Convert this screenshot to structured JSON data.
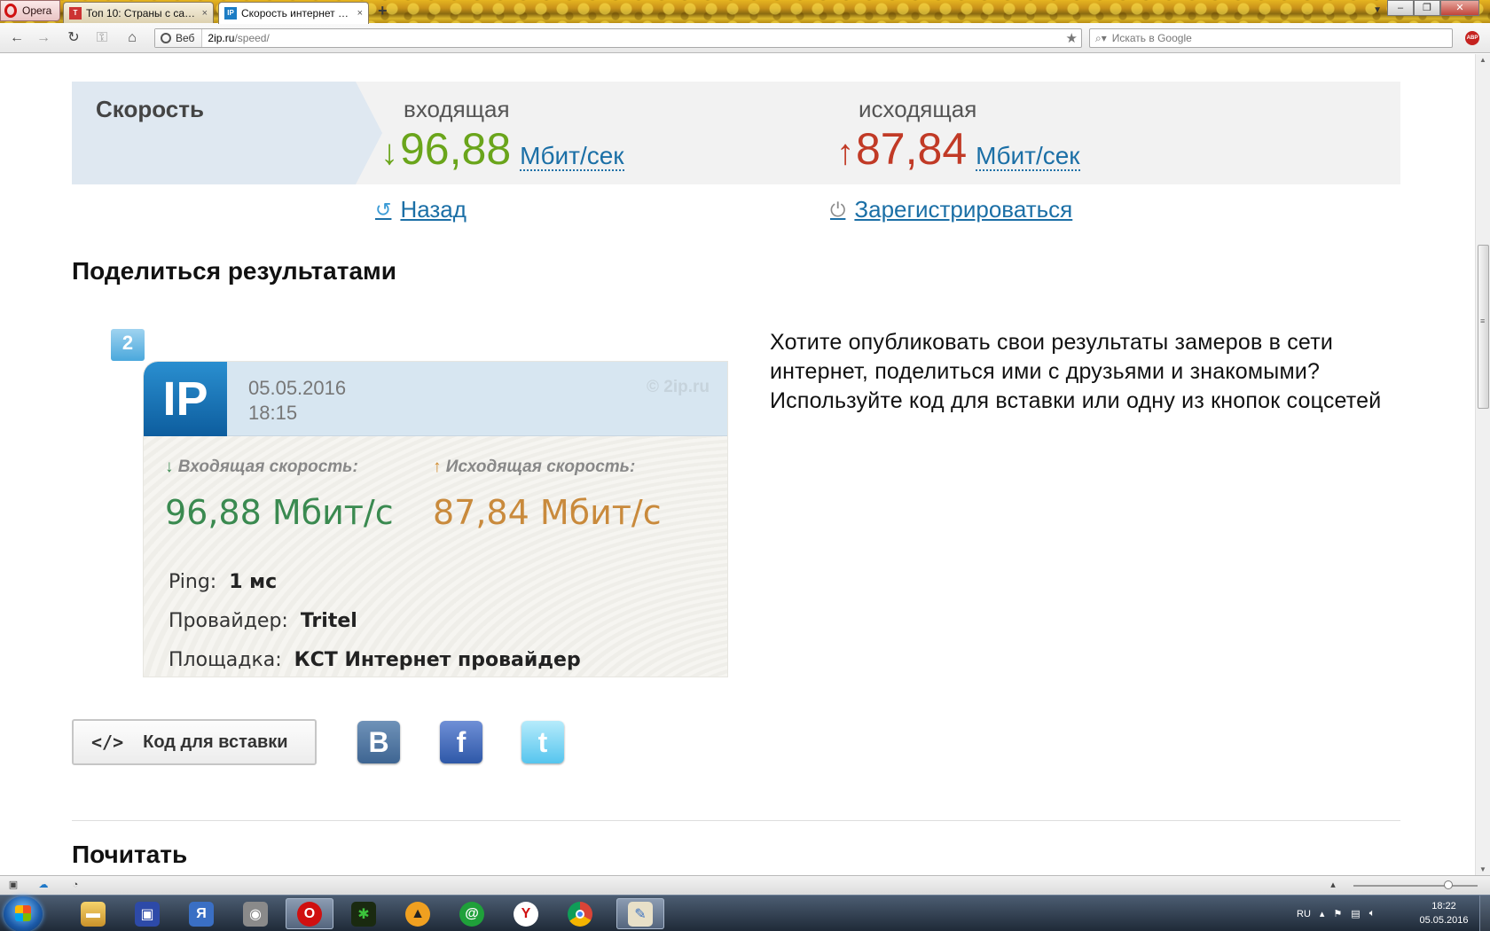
{
  "browser": {
    "menu_label": "Opera",
    "tabs": [
      {
        "title": "Топ 10: Страны с сам...",
        "close": "×"
      },
      {
        "title": "Скорость интернет со...",
        "close": "×"
      }
    ],
    "new_tab": "+",
    "address": {
      "mode_label": "Веб",
      "host": "2ip.ru",
      "path": "/speed/"
    },
    "search_placeholder": "Искать в Google",
    "adblock_label": "ABP"
  },
  "speed": {
    "section_label": "Скорость",
    "incoming_label": "входящая",
    "incoming_arrow": "↓",
    "incoming_value": "96,88",
    "outgoing_label": "исходящая",
    "outgoing_arrow": "↑",
    "outgoing_value": "87,84",
    "unit": "Мбит/сек"
  },
  "links": {
    "back": "Назад",
    "register": "Зарегистрироваться"
  },
  "share": {
    "heading": "Поделиться результатами",
    "description": "Хотите опубликовать свои результаты замеров в сети интернет, поделиться ими с друзьями и знакомыми? Используйте код для вставки или одну из кнопок соцсетей",
    "embed_code_icon": "</>",
    "embed_button": "Код для вставки",
    "social": {
      "vk": "B",
      "facebook": "f",
      "twitter": "t"
    }
  },
  "card": {
    "badge": "2",
    "logo": "IP",
    "date": "05.05.2016",
    "time": "18:15",
    "copyright": "© 2ip.ru",
    "in_arrow": "↓",
    "in_label": "Входящая скорость:",
    "in_value": "96,88 Мбит/с",
    "out_arrow": "↑",
    "out_label": "Исходящая скорость:",
    "out_value": "87,84 Мбит/с",
    "ping_label": "Ping:",
    "ping_value": "1 мс",
    "provider_label": "Провайдер:",
    "provider_value": "Tritel",
    "site_label": "Площадка:",
    "site_value": "КСТ Интернет провайдер"
  },
  "read_heading": "Почитать",
  "taskbar": {
    "lang": "RU",
    "time": "18:22",
    "date": "05.05.2016"
  },
  "colors": {
    "incoming": "#6aa51b",
    "outgoing": "#c13a26",
    "link": "#1b6fa6"
  }
}
